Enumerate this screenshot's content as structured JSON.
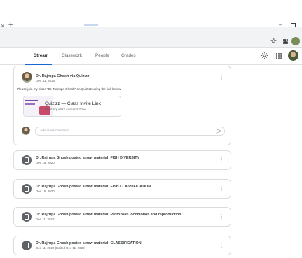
{
  "browser": {
    "tab_close_glyph": "×",
    "new_tab_glyph": "+",
    "minimize_glyph": "–"
  },
  "header": {
    "tabs": [
      {
        "label": "Stream",
        "active": true
      },
      {
        "label": "Classwork",
        "active": false
      },
      {
        "label": "People",
        "active": false
      },
      {
        "label": "Grades",
        "active": false
      }
    ],
    "icons": [
      "gear-icon",
      "apps-grid-icon",
      "avatar"
    ],
    "accent_color": "#1967d2"
  },
  "post": {
    "author": "Dr. Rajrupa Ghosh via Quizizz",
    "date": "Dec 31, 2020",
    "text": "Please join my class \"Dr. Rajrupa Ghosh\" on Quizizz using the link below.",
    "link": {
      "title": "Quizizz — Class Invite Link",
      "url": "https://quizizz.com/join?cho..."
    },
    "comment_placeholder": "Add class comment..."
  },
  "materials": [
    {
      "title": "Dr. Rajrupa Ghosh posted a new material: FISH DIVERSITY",
      "date": "Dec 15, 2020"
    },
    {
      "title": "Dr. Rajrupa Ghosh posted a new material: FISH CLASSIFICATION",
      "date": "Dec 15, 2020"
    },
    {
      "title": "Dr. Rajrupa Ghosh posted a new material: Protozoan locomotion and reproduction",
      "date": "Dec 11, 2020"
    },
    {
      "title": "Dr. Rajrupa Ghosh posted a new material: CLASSIFICATION",
      "date": "Dec 11, 2020 (Edited Dec 11, 2020)"
    }
  ]
}
